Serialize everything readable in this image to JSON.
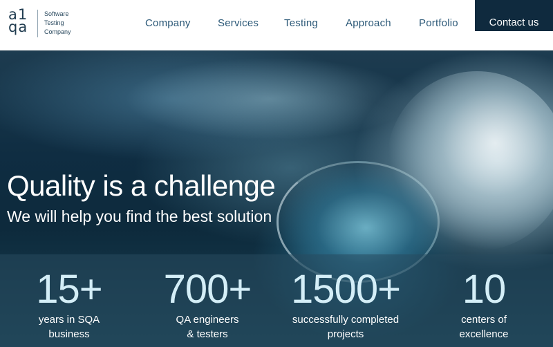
{
  "logo": {
    "mark_top": "a1",
    "mark_bottom": "qa",
    "text_line1": "Software",
    "text_line2": "Testing",
    "text_line3": "Company"
  },
  "nav": {
    "items": [
      {
        "label": "Company"
      },
      {
        "label": "Services"
      },
      {
        "label": "Testing"
      },
      {
        "label": "Approach"
      },
      {
        "label": "Portfolio"
      }
    ],
    "contact_label": "Contact us"
  },
  "hero": {
    "title": "Quality is a challenge",
    "subtitle": "We will help you find the best solution"
  },
  "stats": [
    {
      "number": "15+",
      "label_line1": "years in SQA",
      "label_line2": "business"
    },
    {
      "number": "700+",
      "label_line1": "QA engineers",
      "label_line2": "& testers"
    },
    {
      "number": "1500+",
      "label_line1": "successfully completed",
      "label_line2": "projects"
    },
    {
      "number": "10",
      "label_line1": "centers of",
      "label_line2": "excellence"
    }
  ],
  "colors": {
    "brand_dark": "#0f2a3e",
    "nav_text": "#2b5877",
    "hero_text": "#ffffff",
    "stat_number": "#d4eef7"
  }
}
